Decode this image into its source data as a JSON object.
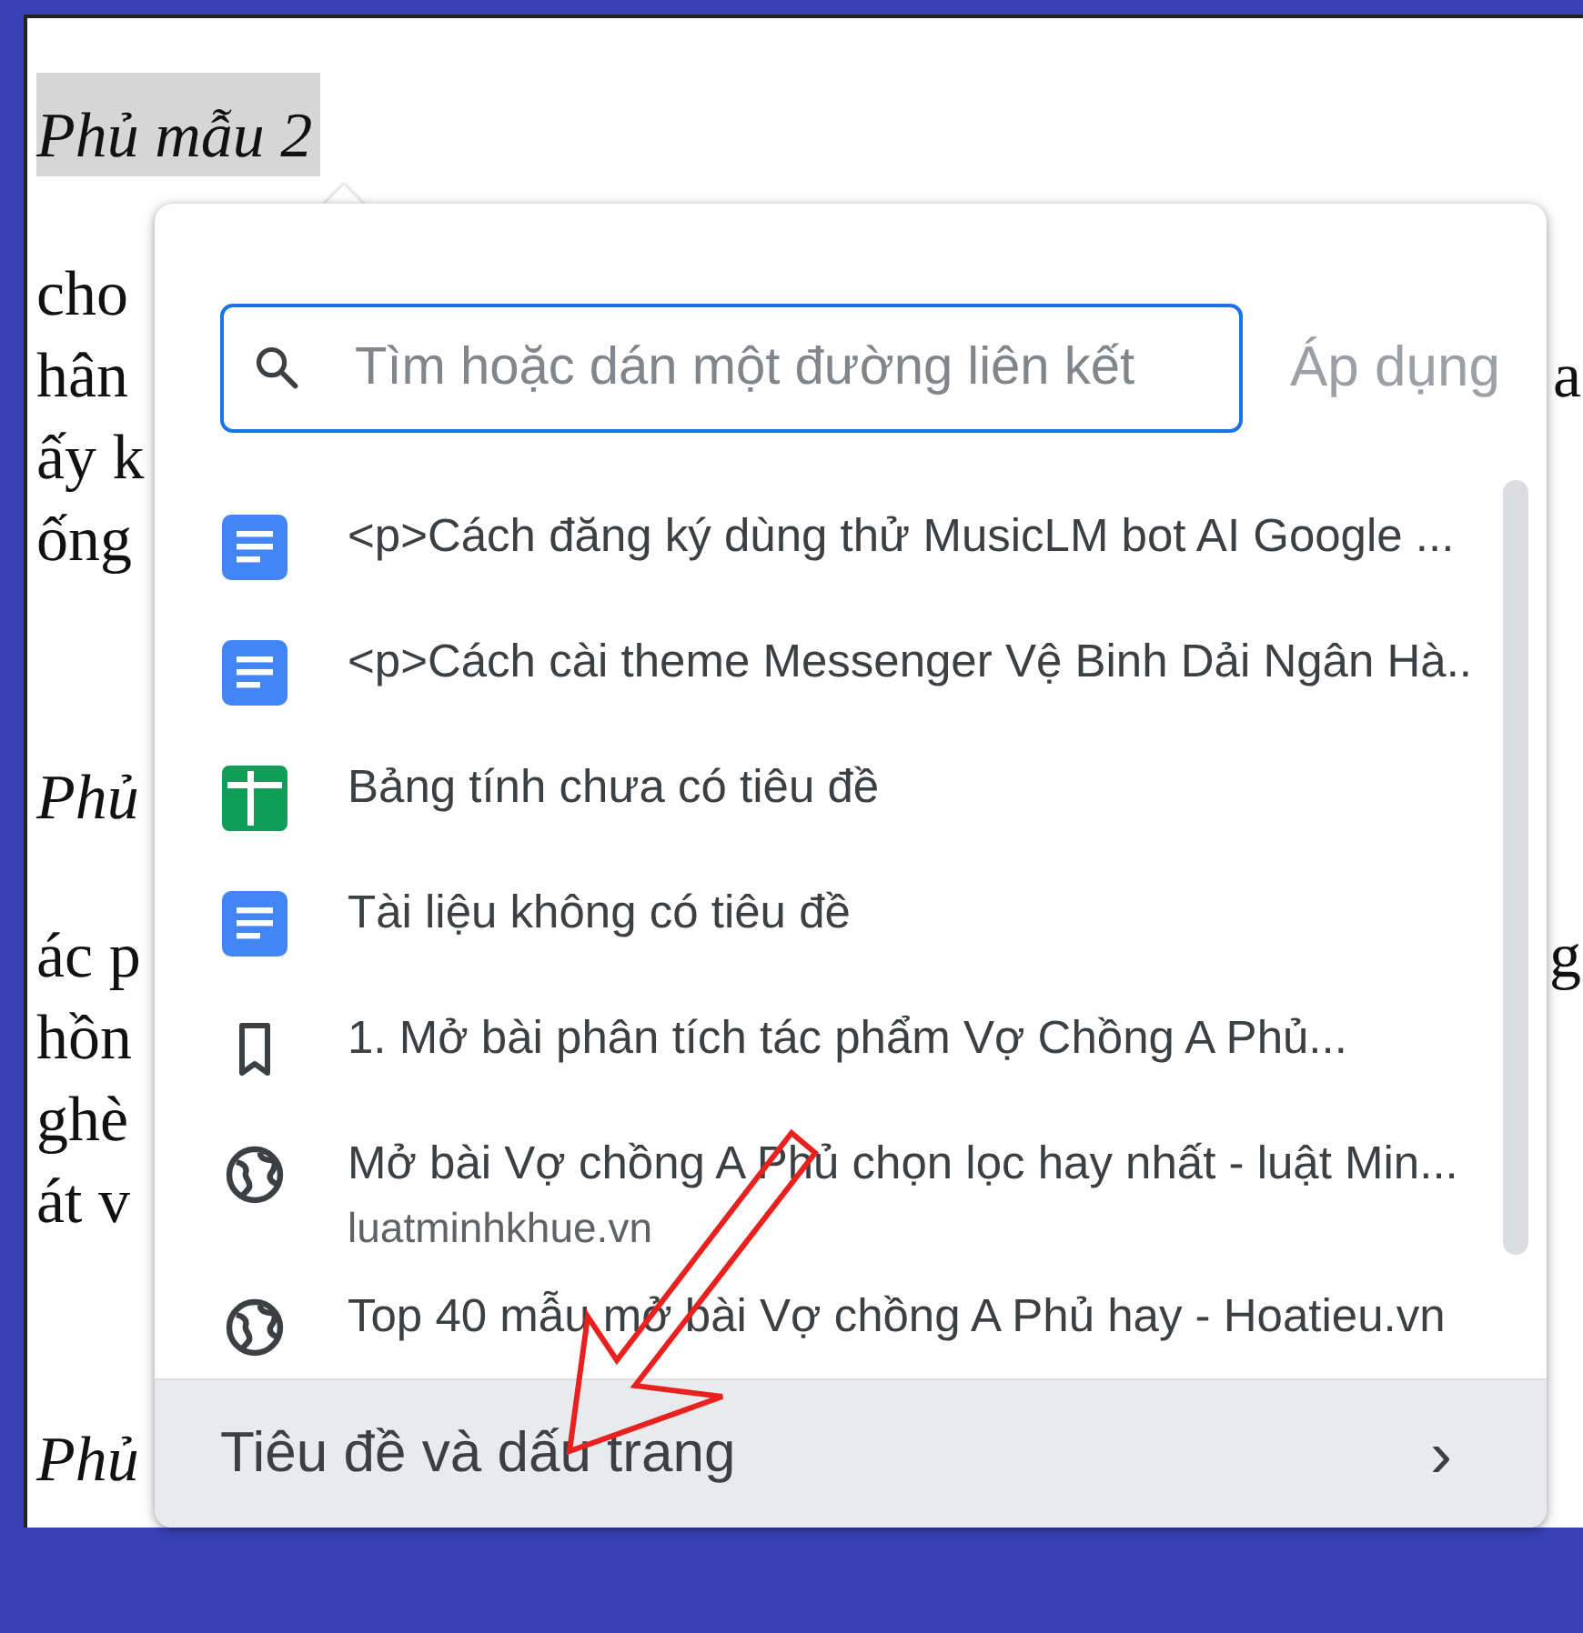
{
  "document": [
    {
      "kind": "heading",
      "lines": [
        {
          "text": "Phủ mẫu 2"
        }
      ]
    },
    {
      "kind": "paragraph",
      "lines": [
        {
          "text": "cho"
        },
        {
          "text": "hân",
          "tail": "a"
        },
        {
          "text": "ấy k"
        },
        {
          "text": "ống"
        }
      ]
    },
    {
      "kind": "heading",
      "lines": [
        {
          "text": "Phủ"
        }
      ]
    },
    {
      "kind": "paragraph",
      "lines": [
        {
          "text": "ác p",
          "tail": "g"
        },
        {
          "text": "hồn"
        },
        {
          "text": "ghè"
        },
        {
          "text": "át v"
        }
      ]
    },
    {
      "kind": "heading",
      "lines": [
        {
          "text": "Phủ"
        }
      ]
    }
  ],
  "link_popup": {
    "search": {
      "placeholder": "Tìm hoặc dán một đường liên kết"
    },
    "apply_button": {
      "label": "Áp dụng",
      "disabled": true
    },
    "suggestions": [
      {
        "kind": "doc",
        "title": "<p>Cách đăng ký dùng thử MusicLM bot AI Google ..."
      },
      {
        "kind": "doc",
        "title": "<p>Cách cài theme Messenger Vệ Binh Dải Ngân Hà.."
      },
      {
        "kind": "sheet",
        "title": "Bảng tính chưa có tiêu đề"
      },
      {
        "kind": "doc",
        "title": "Tài liệu không có tiêu đề"
      },
      {
        "kind": "bookmark",
        "title": "1. Mở bài phân tích tác phẩm Vợ Chồng A Phủ..."
      },
      {
        "kind": "web",
        "title": "Mở bài Vợ chồng A Phủ chọn lọc hay nhất - luật Min...",
        "url": "luatminhkhue.vn"
      },
      {
        "kind": "web",
        "title": "Top 40 mẫu mở bài Vợ chồng A Phủ hay - Hoatieu.vn"
      }
    ],
    "footer": {
      "label": "Tiêu đề và dấu trang",
      "chevron": "›"
    }
  }
}
